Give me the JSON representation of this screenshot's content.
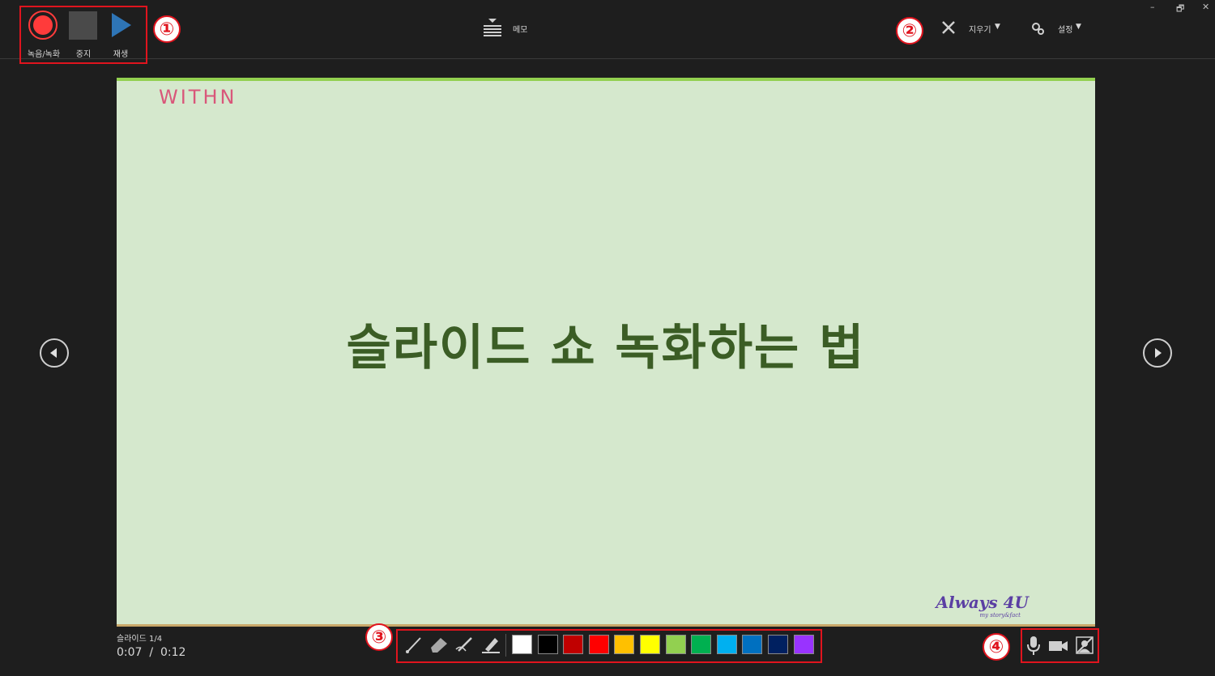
{
  "window": {
    "minimize": "–",
    "restore": "🗗",
    "close": "✕"
  },
  "recording": {
    "record_label": "녹음/녹화",
    "stop_label": "중지",
    "play_label": "재생"
  },
  "notes": {
    "label": "메모"
  },
  "clear": {
    "label": "지우기"
  },
  "settings": {
    "label": "설정"
  },
  "callouts": [
    "①",
    "②",
    "③",
    "④"
  ],
  "slide": {
    "logo": "WITHN",
    "title": "슬라이드 쇼 녹화하는 법",
    "brand": "Always 4U",
    "brand_sub": "my story&fact"
  },
  "status": {
    "slide_counter": "슬라이드 1/4",
    "time": "0:07  /  0:12"
  },
  "pen_colors": [
    "#ffffff",
    "#000000",
    "#c00000",
    "#ff0000",
    "#ffc000",
    "#ffff00",
    "#92d050",
    "#00b050",
    "#00b0f0",
    "#0070c0",
    "#002060",
    "#9933ff"
  ],
  "icons": {
    "record": "record-icon",
    "stop": "stop-icon",
    "play": "play-icon",
    "notes": "notes-icon",
    "clear": "close-x-icon",
    "settings": "gear-icon",
    "prev": "previous-slide-icon",
    "next": "next-slide-icon",
    "pen": "pen-icon",
    "eraser": "eraser-icon",
    "pencil": "pencil-icon",
    "highlighter": "highlighter-icon",
    "mic": "microphone-icon",
    "camera": "camera-icon",
    "camera_preview": "camera-preview-off-icon"
  },
  "colors": {
    "accent_red": "#e0141e",
    "slide_bg": "#d5e8cd",
    "title": "#3b5d25",
    "play_blue": "#2e75b6"
  }
}
